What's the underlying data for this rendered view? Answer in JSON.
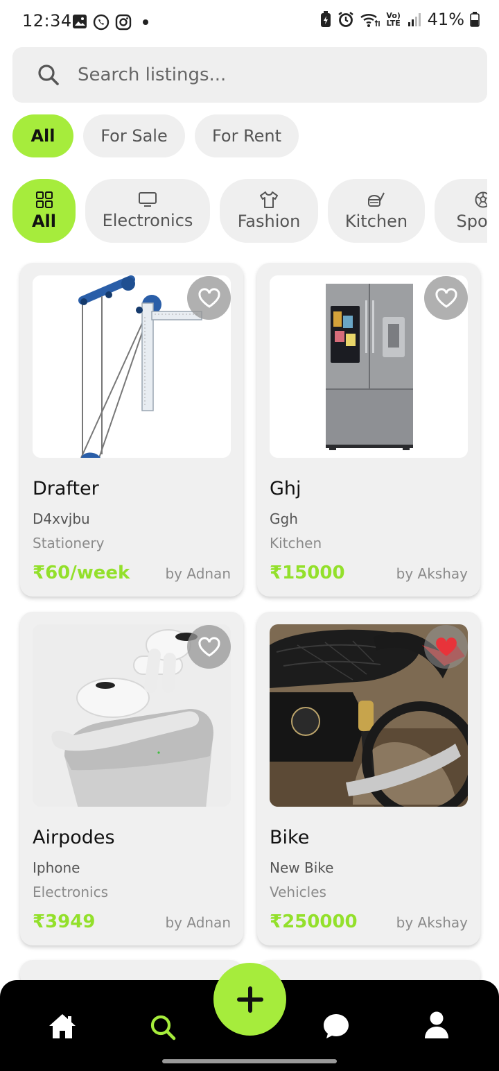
{
  "status_bar": {
    "time": "12:34",
    "battery": "41%",
    "network": "Vo) LTE",
    "icons_left": [
      "gallery-icon",
      "whatsapp-icon",
      "instagram-icon",
      "dot-icon"
    ],
    "icons_right": [
      "battery-saver-icon",
      "alarm-icon",
      "wifi-icon",
      "signal-icon",
      "battery-icon"
    ]
  },
  "search": {
    "placeholder": "Search listings..."
  },
  "filters": [
    {
      "label": "All",
      "active": true
    },
    {
      "label": "For Sale",
      "active": false
    },
    {
      "label": "For Rent",
      "active": false
    }
  ],
  "categories": [
    {
      "label": "All",
      "icon": "grid-icon",
      "active": true
    },
    {
      "label": "Electronics",
      "icon": "monitor-icon",
      "active": false
    },
    {
      "label": "Fashion",
      "icon": "shirt-icon",
      "active": false
    },
    {
      "label": "Kitchen",
      "icon": "kitchen-icon",
      "active": false
    },
    {
      "label": "Sports",
      "icon": "ball-icon",
      "active": false
    }
  ],
  "listings": [
    {
      "title": "Drafter",
      "description": "D4xvjbu",
      "category": "Stationery",
      "price": "₹60/week",
      "seller": "by Adnan",
      "favorited": false,
      "image": "drafter"
    },
    {
      "title": "Ghj",
      "description": "Ggh",
      "category": "Kitchen",
      "price": "₹15000",
      "seller": "by Akshay",
      "favorited": false,
      "image": "fridge"
    },
    {
      "title": "Airpodes",
      "description": "Iphone",
      "category": "Electronics",
      "price": "₹3949",
      "seller": "by Adnan",
      "favorited": false,
      "image": "airpods"
    },
    {
      "title": "Bike",
      "description": "New Bike",
      "category": "Vehicles",
      "price": "₹250000",
      "seller": "by Akshay",
      "favorited": true,
      "image": "motorcycle"
    }
  ],
  "bottom_nav": {
    "items": [
      "home-icon",
      "search-icon",
      "add-icon",
      "chat-icon",
      "profile-icon"
    ],
    "active": "search-icon"
  },
  "colors": {
    "accent": "#a6ec3c",
    "price": "#93e02b",
    "chip_bg": "#efefef",
    "favorite": "#e8333a",
    "nav_bg": "#000000"
  }
}
